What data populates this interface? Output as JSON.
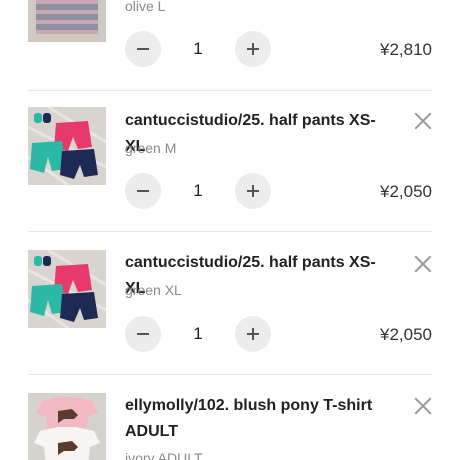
{
  "cart": {
    "items": [
      {
        "title": "",
        "variant": "olive L",
        "quantity": "1",
        "price": "¥2,810",
        "thumb_icon": "striped-shirt-photo",
        "decrease_icon": "minus-icon",
        "increase_icon": "plus-icon"
      },
      {
        "title": "cantuccistudio/25. half pants XS-XL",
        "variant": "green M",
        "quantity": "1",
        "price": "¥2,050",
        "thumb_icon": "half-pants-photo",
        "remove_icon": "close-icon",
        "decrease_icon": "minus-icon",
        "increase_icon": "plus-icon"
      },
      {
        "title": "cantuccistudio/25. half pants XS-XL",
        "variant": "green XL",
        "quantity": "1",
        "price": "¥2,050",
        "thumb_icon": "half-pants-photo",
        "remove_icon": "close-icon",
        "decrease_icon": "minus-icon",
        "increase_icon": "plus-icon"
      },
      {
        "title": "ellymolly/102. blush pony T-shirt ADULT",
        "variant": "ivory ADULT",
        "thumb_icon": "pony-tshirt-photo",
        "remove_icon": "close-icon"
      }
    ]
  },
  "colors": {
    "stepper_bg": "#ececec",
    "divider": "#e6e6e6",
    "muted_text": "#8a8a8a"
  }
}
